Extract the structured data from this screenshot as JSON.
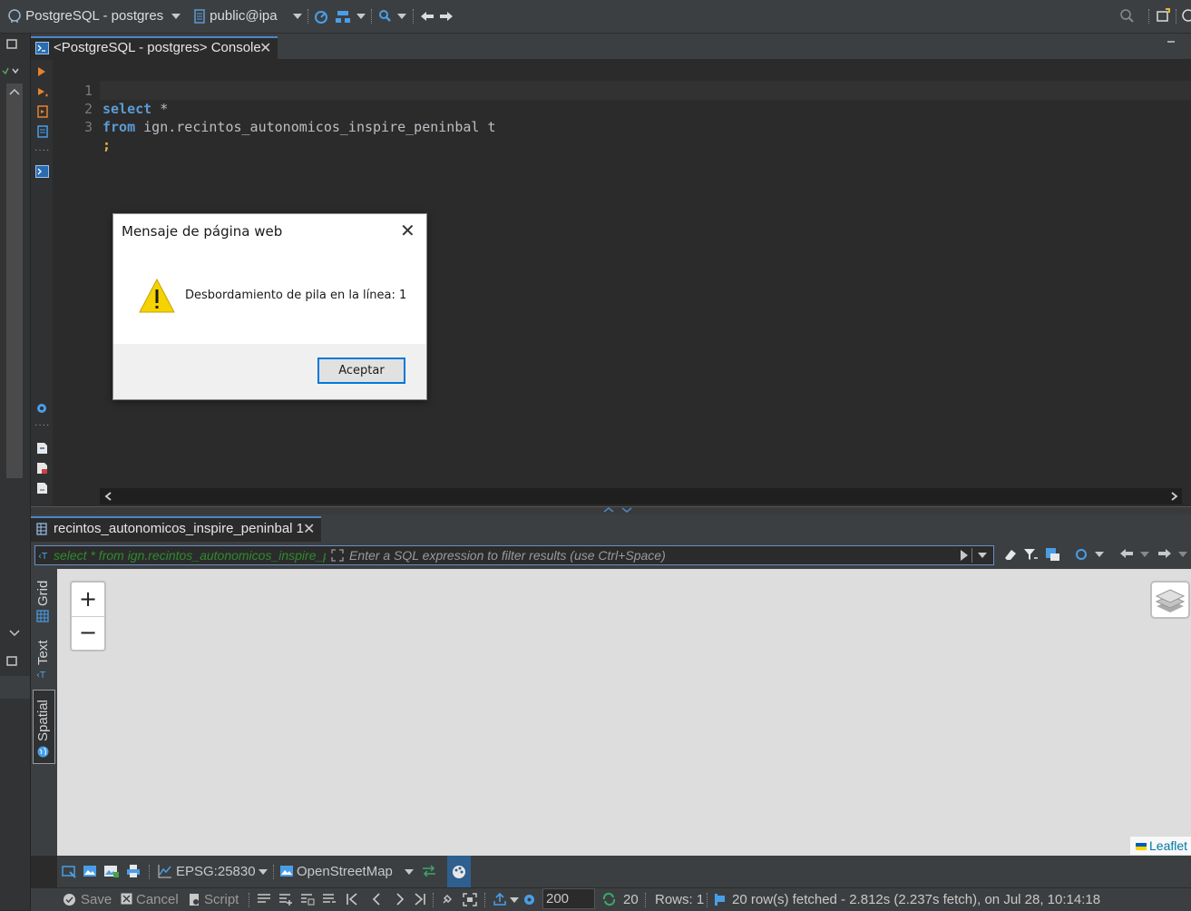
{
  "toolbar": {
    "connection": "PostgreSQL - postgres",
    "schema": "public@ipa"
  },
  "editor": {
    "tab_title": "<PostgreSQL - postgres> Console",
    "lines": [
      {
        "num": "1",
        "keyword": "select",
        "rest": " *"
      },
      {
        "num": "2",
        "keyword": "from",
        "rest": " ign.recintos_autonomicos_inspire_peninbal t"
      },
      {
        "num": "3",
        "keyword": "",
        "rest": ";"
      }
    ]
  },
  "dialog": {
    "title": "Mensaje de página web",
    "message": "Desbordamiento de pila en la línea: 1",
    "ok_label": "Aceptar"
  },
  "results": {
    "tab_title": "recintos_autonomicos_inspire_peninbal 1",
    "filter_query": "select * from ign.recintos_autonomicos_inspire_peninbal t",
    "filter_placeholder": "Enter a SQL expression to filter results (use Ctrl+Space)",
    "vertical_tabs": {
      "grid": "Grid",
      "text": "Text",
      "spatial": "Spatial"
    }
  },
  "map": {
    "zoom_in": "+",
    "zoom_out": "−",
    "attribution": "Leaflet",
    "crs": "EPSG:25830",
    "basemap": "OpenStreetMap"
  },
  "status": {
    "save": "Save",
    "cancel": "Cancel",
    "script": "Script",
    "fetch_size": "200",
    "row_count": "20",
    "rows": "Rows: 1",
    "message": "20 row(s) fetched - 2.812s (2.237s fetch), on Jul 28, 10:14:18"
  },
  "colors": {
    "accent": "#4a88c7",
    "keyword": "#5b9bd5",
    "warning": "#f5d300"
  }
}
